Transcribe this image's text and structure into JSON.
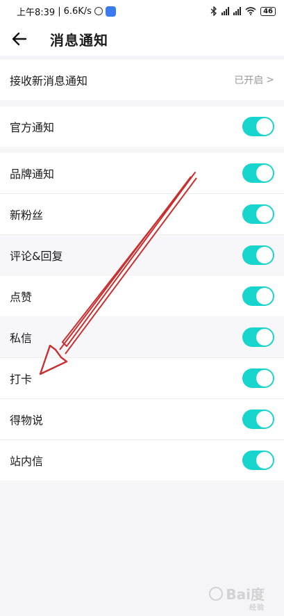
{
  "status_bar": {
    "time": "上午8:39",
    "separator": "|",
    "speed": "6.6K/s",
    "battery": "46",
    "icons": [
      "alarm-icon",
      "app-badge-icon",
      "bluetooth-icon",
      "signal-icon",
      "signal-icon",
      "wifi-icon",
      "battery-icon"
    ]
  },
  "header": {
    "back_icon": "arrow-left-icon",
    "title": "消息通知"
  },
  "receive": {
    "label": "接收新消息通知",
    "value": "已开启",
    "chevron": ">"
  },
  "settings": [
    {
      "label": "官方通知",
      "enabled": true
    },
    {
      "label": "品牌通知",
      "enabled": true
    },
    {
      "label": "新粉丝",
      "enabled": true
    },
    {
      "label": "评论&回复",
      "enabled": true
    },
    {
      "label": "点赞",
      "enabled": true
    },
    {
      "label": "私信",
      "enabled": true
    },
    {
      "label": "打卡",
      "enabled": true
    },
    {
      "label": "得物说",
      "enabled": true
    },
    {
      "label": "站内信",
      "enabled": true
    }
  ],
  "colors": {
    "toggle_on": "#17d4cc",
    "annotation_arrow": "#c8302f"
  },
  "watermark": {
    "text": "Bai度",
    "sub": "经验"
  }
}
